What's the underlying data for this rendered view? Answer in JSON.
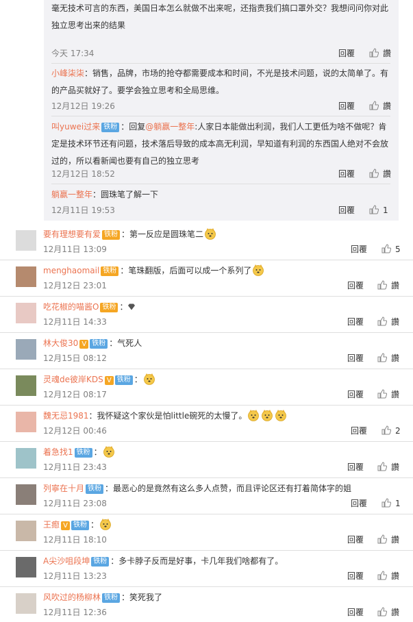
{
  "nested_replies": [
    {
      "user": "",
      "text": "毫无技术可言的东西，美国日本怎么就做不出来呢，还指责我们搞口罩外交？我想问问你对此独立思考出来的结果",
      "time": "今天 17:34",
      "reply": "回覆",
      "like": "讚"
    },
    {
      "user": "小峰柒柒",
      "text": "：销售，品牌，市场的抢夺都需要成本和时间，不光是技术问题，说的太简单了。有的产品买就好了。要学会独立思考和全局思维。",
      "time": "12月12日 19:26",
      "reply": "回覆",
      "like": "讚"
    },
    {
      "user": "叫yuwei过来",
      "badge": "铁粉",
      "text_prefix": "：回复",
      "mention": "@躺赢一整年",
      "text": ":人家日本能做出利润，我们人工更低为啥不做呢？肯定是技术环节还有问题，技术落后导致的成本高无利润，早知道有利润的东西国人绝对不会放过的，所以看新闻也要有自己的独立思考",
      "time": "12月12日 18:52",
      "reply": "回覆",
      "like": "讚"
    },
    {
      "user": "躺赢一整年",
      "text": "：圆珠笔了解一下",
      "time": "12月11日 19:53",
      "reply": "回覆",
      "like": "1"
    }
  ],
  "comments": [
    {
      "user": "要有理想要有爱",
      "badge": "铁粉",
      "badge_style": "gold",
      "text": "：第一反应是圆珠笔二",
      "emojis": 1,
      "time": "12月11日 13:09",
      "reply": "回覆",
      "like": "5"
    },
    {
      "user": "menghaomail",
      "badge": "铁粉",
      "badge_style": "gold",
      "text": "：笔珠翻版，后面可以成一个系列了",
      "emojis": 1,
      "time": "12月12日 23:01",
      "reply": "回覆",
      "like": "讚"
    },
    {
      "user": "吃花椒的喵酱O",
      "badge": "铁粉",
      "badge_style": "gold",
      "text": "：",
      "gem": true,
      "emojis": 0,
      "time": "12月11日 14:33",
      "reply": "回覆",
      "like": "讚"
    },
    {
      "user": "林大俊30",
      "vip": true,
      "badge": "铁粉",
      "text": "：气死人",
      "emojis": 0,
      "time": "12月15日 08:12",
      "reply": "回覆",
      "like": "讚"
    },
    {
      "user": "灵魂de彼岸KDS",
      "vip": true,
      "badge": "铁粉",
      "text": "：",
      "emojis": 1,
      "time": "12月12日 08:17",
      "reply": "回覆",
      "like": "讚"
    },
    {
      "user": "魏无忌1981",
      "text": "：我怀疑这个家伙是怕little碗死的太慢了。",
      "emojis": 3,
      "time": "12月12日 00:46",
      "reply": "回覆",
      "like": "2"
    },
    {
      "user": "着急找1",
      "badge": "铁粉",
      "text": "：",
      "emojis": 1,
      "time": "12月11日 23:43",
      "reply": "回覆",
      "like": "讚"
    },
    {
      "user": "列寧在十月",
      "badge": "铁粉",
      "text": "：最恶心的是竟然有这么多人点赞，而且评论区还有打着简体字的姐",
      "emojis": 0,
      "time": "12月11日 23:08",
      "reply": "回覆",
      "like": "1"
    },
    {
      "user": "王瘛",
      "vip": true,
      "badge": "铁粉",
      "text": "：",
      "emojis": 1,
      "time": "12月11日 18:10",
      "reply": "回覆",
      "like": "讚"
    },
    {
      "user": "A尖沙咀段坤",
      "badge": "铁粉",
      "text": "：多卡脖子反而是好事，卡几年我们啥都有了。",
      "emojis": 0,
      "time": "12月11日 13:23",
      "reply": "回覆",
      "like": "讚"
    },
    {
      "user": "风吹过的杨柳林",
      "badge": "铁粉",
      "text": "：笑死我了",
      "emojis": 0,
      "time": "12月11日 12:36",
      "reply": "回覆",
      "like": "讚"
    }
  ],
  "colors": {
    "username": "#eb7350",
    "badge": "#5aa6e2",
    "badge_gold": "#f5a623",
    "nested_bg": "#f2f2f5",
    "time": "#808080"
  }
}
